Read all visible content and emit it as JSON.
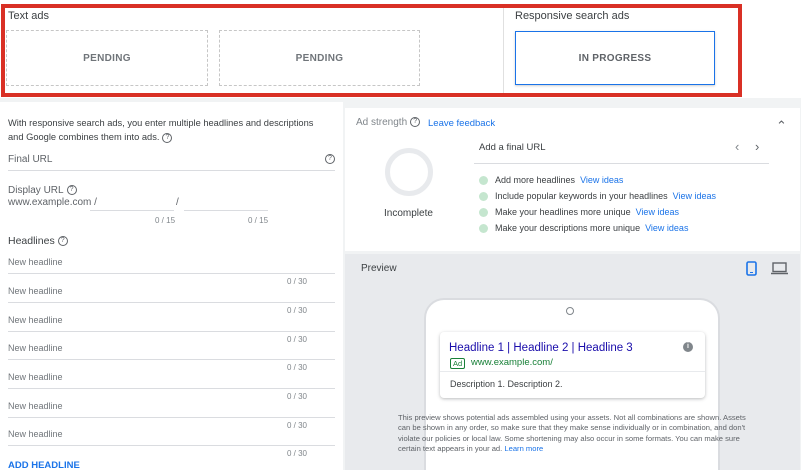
{
  "text_ads": {
    "label": "Text ads",
    "slots": [
      {
        "status": "PENDING"
      },
      {
        "status": "PENDING"
      }
    ]
  },
  "responsive_ads": {
    "label": "Responsive search ads",
    "slot_status": "IN PROGRESS"
  },
  "form": {
    "intro": "With responsive search ads, you enter multiple headlines and descriptions and Google combines them into ads.",
    "final_url_placeholder": "Final URL",
    "display_url_label": "Display URL",
    "display_url_domain": "www.example.com /",
    "path_separator": "/",
    "path1_count": "0 / 15",
    "path2_count": "0 / 15",
    "headlines_label": "Headlines",
    "headline_placeholder": "New headline",
    "headline_counter": "0 / 30",
    "add_headline_label": "ADD HEADLINE"
  },
  "ad_strength": {
    "title": "Ad strength",
    "feedback_link": "Leave feedback",
    "rating": "Incomplete",
    "nav_title": "Add a final URL",
    "suggestions": [
      {
        "text": "Add more headlines",
        "link": "View ideas"
      },
      {
        "text": "Include popular keywords in your headlines",
        "link": "View ideas"
      },
      {
        "text": "Make your headlines more unique",
        "link": "View ideas"
      },
      {
        "text": "Make your descriptions more unique",
        "link": "View ideas"
      }
    ]
  },
  "preview": {
    "title": "Preview",
    "ad_headline": "Headline 1 | Headline 2 | Headline 3",
    "ad_badge": "Ad",
    "ad_url": "www.example.com/",
    "ad_description": "Description 1. Description 2.",
    "disclaimer": "This preview shows potential ads assembled using your assets. Not all combinations are shown. Assets can be shown in any order, so make sure that they make sense individually or in combination, and don't violate our policies or local law. Some shortening may also occur in some formats. You can make sure certain text appears in your ad.",
    "learn_more": "Learn more"
  },
  "colors": {
    "accent": "#1a73e8",
    "highlight": "#d93025",
    "strength_dot": "#c5e6cf"
  }
}
